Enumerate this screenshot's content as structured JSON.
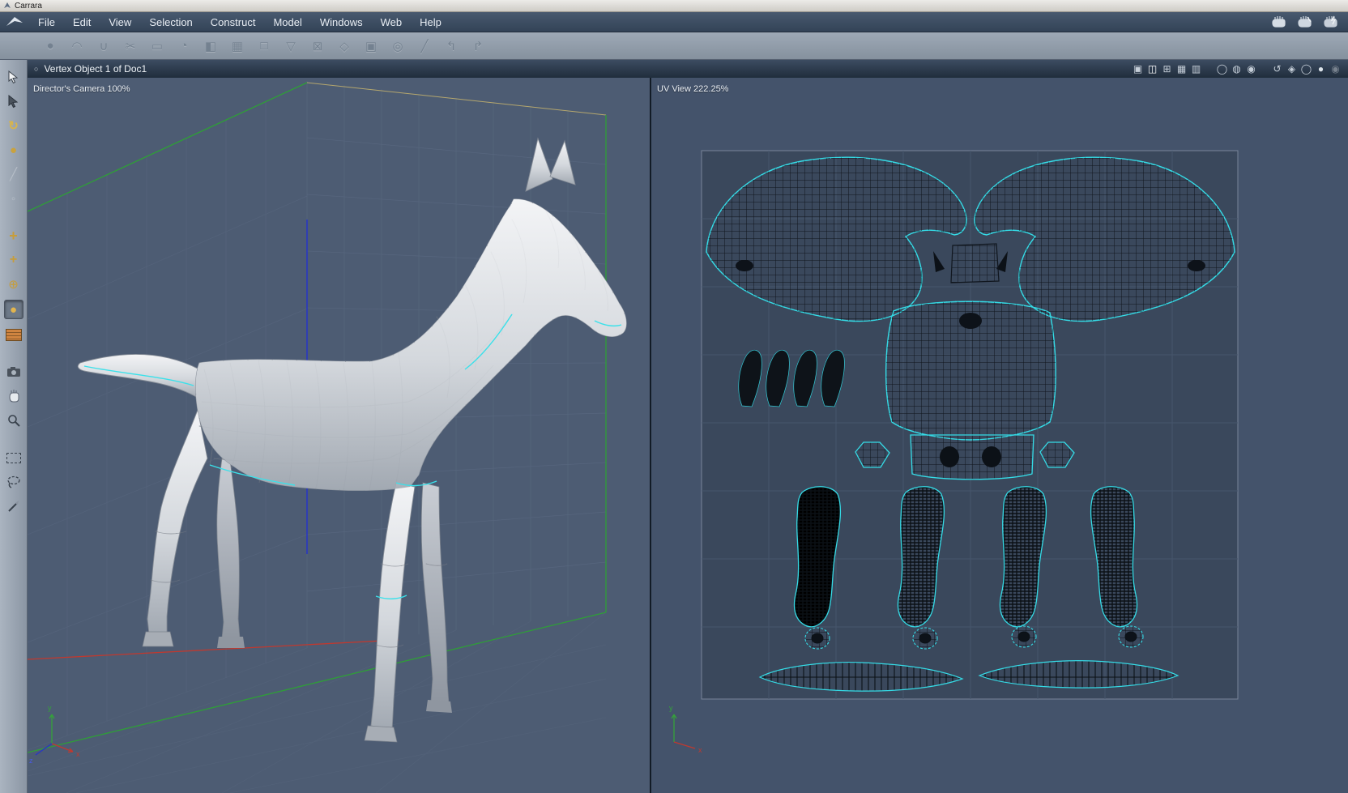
{
  "window": {
    "title": "Carrara"
  },
  "menu_bar": {
    "items": [
      "File",
      "Edit",
      "View",
      "Selection",
      "Construct",
      "Model",
      "Windows",
      "Web",
      "Help"
    ]
  },
  "room_bar": {
    "rooms": [
      "assemble-room",
      "texture-room",
      "render-room"
    ]
  },
  "toolbar": {
    "glyphs": [
      "●",
      "◠",
      "∪",
      "✂",
      "▭",
      "◔",
      "◧",
      "▦",
      "□",
      "▽",
      "⊠",
      "◇",
      "▣",
      "◎",
      "╱",
      "↰",
      "↱"
    ],
    "names": [
      "sphere-tool",
      "arc-tool",
      "magnet-tool",
      "scissors-tool",
      "plane-tool",
      "dome-tool",
      "half-shell-tool",
      "grid-tool",
      "cube-tool",
      "cone-tool",
      "delete-face-tool",
      "diamond-tool",
      "fill-face-tool",
      "target-tool",
      "line-tool",
      "sweep-left-tool",
      "sweep-right-tool"
    ]
  },
  "palette": {
    "glyphs": {
      "rotate": "↻",
      "sphere": "●",
      "line": "╱",
      "pick": "◦",
      "move": "+",
      "scale": "+",
      "axis": "⊕",
      "projection": "●"
    }
  },
  "document": {
    "title": "Vertex Object 1 of Doc1",
    "bullet": "○",
    "layout_icons": [
      "▣",
      "◫",
      "⊞",
      "▦",
      "▥"
    ],
    "mode_icons": [
      "◯",
      "◍",
      "◉"
    ],
    "view_icons": [
      "↺",
      "◈",
      "◯",
      "●",
      "◉"
    ]
  },
  "viewports": {
    "camera": {
      "label": "Director's Camera 100%"
    },
    "uv": {
      "label": "UV View 222.25%"
    }
  },
  "axes": {
    "x": "x",
    "y": "y",
    "z": "z"
  },
  "colors": {
    "accent_cyan": "#3ae1ea",
    "axis_x": "#c0392f",
    "axis_y": "#35a23a",
    "axis_z": "#2635c8",
    "viewport_bg": "#4d5c73",
    "uv_panel_bg": "#3a485c"
  }
}
